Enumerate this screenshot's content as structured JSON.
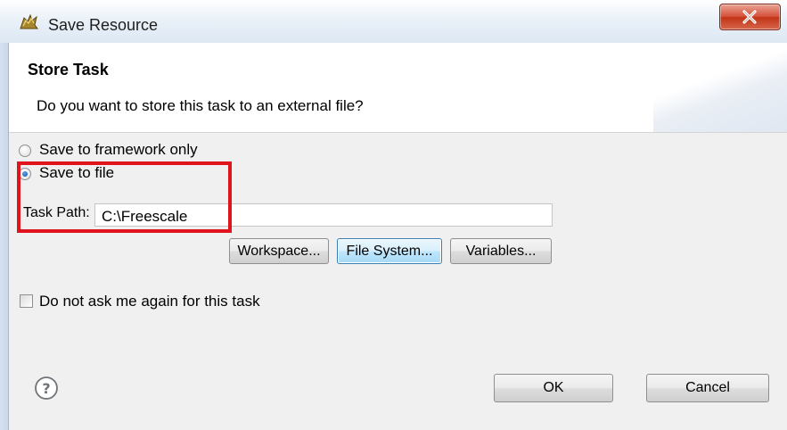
{
  "window": {
    "title": "Save Resource",
    "icon": "eclipse-plugin-icon",
    "close_icon": "close-icon"
  },
  "header": {
    "title": "Store Task",
    "message": "Do you want to store this task to an external file?"
  },
  "options": {
    "framework_only_label": "Save to framework only",
    "save_to_file_label": "Save to file",
    "selected": "Save to file"
  },
  "task_path": {
    "label": "Task Path:",
    "value": "C:\\Freescale"
  },
  "browse_buttons": {
    "workspace": "Workspace...",
    "file_system": "File System...",
    "variables": "Variables..."
  },
  "checkbox": {
    "label": "Do not ask me again for this task",
    "checked": false
  },
  "footer": {
    "help_icon": "help-icon",
    "ok": "OK",
    "cancel": "Cancel"
  },
  "colors": {
    "highlight": "#e0141c",
    "close_button": "#c23416",
    "focus_border": "#3c7fb1"
  }
}
